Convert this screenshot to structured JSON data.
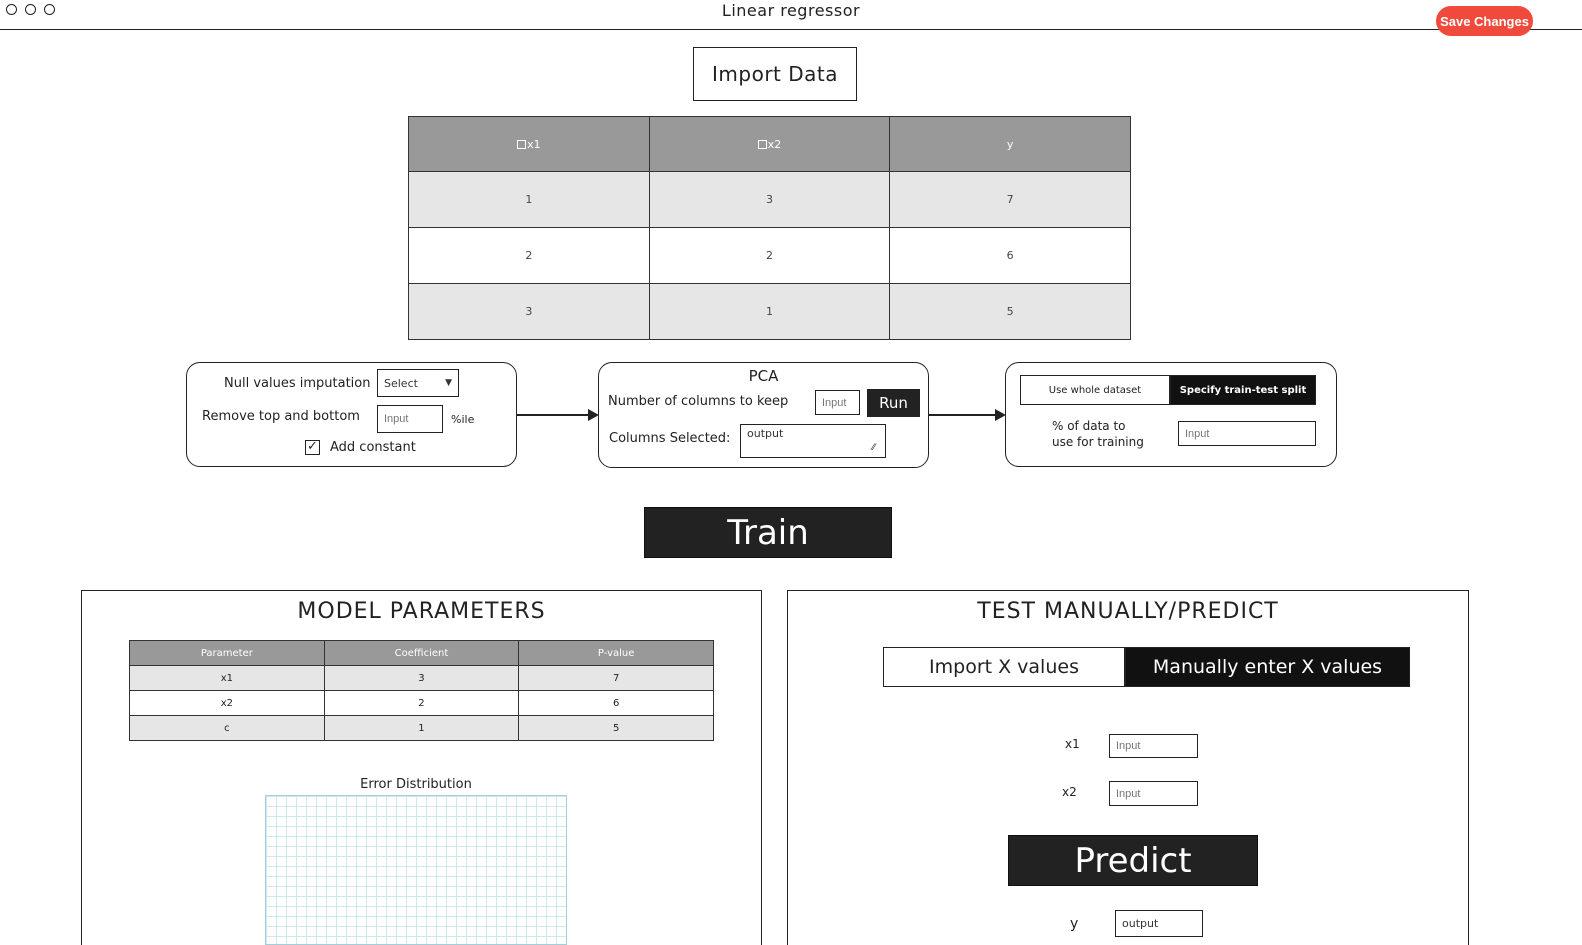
{
  "window": {
    "title": "Linear regressor",
    "save_label": "Save Changes",
    "accent": "#f04a3c"
  },
  "import": {
    "label": "Import Data"
  },
  "data_table": {
    "headers": [
      "x1",
      "x2",
      "y"
    ],
    "rows": [
      [
        "1",
        "3",
        "7"
      ],
      [
        "2",
        "2",
        "6"
      ],
      [
        "3",
        "1",
        "5"
      ]
    ]
  },
  "preprocess": {
    "null_label": "Null values imputation",
    "null_select": "Select",
    "remove_label": "Remove top and bottom",
    "remove_placeholder": "Input",
    "remove_unit": "%ile",
    "constant_label": "Add constant",
    "constant_checked": true
  },
  "pca": {
    "title": "PCA",
    "columns_label": "Number of columns to keep",
    "columns_placeholder": "Input",
    "run_label": "Run",
    "selected_label": "Columns Selected:",
    "selected_output": "output"
  },
  "split": {
    "option_whole": "Use whole dataset",
    "option_split": "Specify train-test split",
    "percent_label_line1": "% of data to",
    "percent_label_line2": "use for training",
    "percent_placeholder": "Input"
  },
  "train": {
    "label": "Train"
  },
  "model": {
    "title": "MODEL PARAMETERS",
    "headers": [
      "Parameter",
      "Coefficient",
      "P-value"
    ],
    "rows": [
      [
        "x1",
        "3",
        "7"
      ],
      [
        "x2",
        "2",
        "6"
      ],
      [
        "c",
        "1",
        "5"
      ]
    ],
    "chart_title": "Error Distribution"
  },
  "predict": {
    "title": "TEST MANUALLY/PREDICT",
    "tab_import": "Import X values",
    "tab_manual": "Manually enter X values",
    "x1_label": "x1",
    "x1_placeholder": "Input",
    "x2_label": "x2",
    "x2_placeholder": "Input",
    "predict_label": "Predict",
    "y_label": "y",
    "y_output": "output"
  }
}
